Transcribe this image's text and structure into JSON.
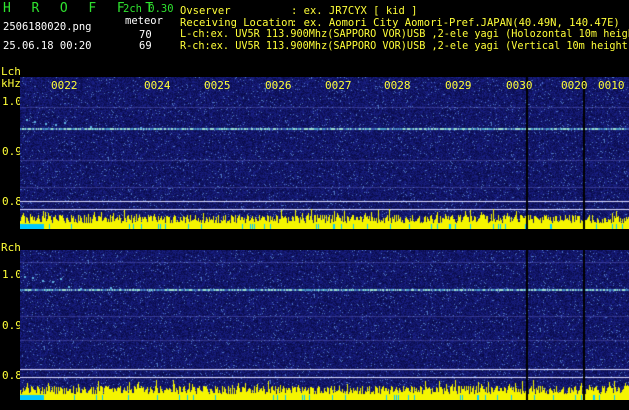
{
  "header": {
    "app_title": "H R O F F T",
    "mode": "2ch 0.30",
    "category": "meteor",
    "filename": "2506180020.png",
    "datetime": "25.06.18 00:20",
    "lch_count": "70",
    "rch_count": "69",
    "observer_label": "Ovserver",
    "observer_value": ": ex. JR7CYX [ kid ]",
    "location_label": "Receiving Location",
    "location_value": ": ex. Aomori City Aomori-Pref.JAPAN(40.49N, 140.47E)",
    "lch_info": "L-ch:ex. UV5R 113.900Mhz(SAPPORO VOR)USB ,2-ele yagi (Holozontal 10m height)",
    "rch_info": "R-ch:ex. UV5R 113.900Mhz(SAPPORO VOR)USB ,2-ele yagi (Vertical 10m height)"
  },
  "lch": {
    "label": "Lch",
    "unit": "kHz",
    "time_ticks": [
      "0022",
      "0024",
      "0025",
      "0026",
      "0027",
      "0028",
      "0029",
      "0030",
      "0020",
      "0010"
    ],
    "freq_ticks": [
      "1.0",
      "0.9",
      "0.8"
    ]
  },
  "rch": {
    "label": "Rch",
    "freq_ticks": [
      "1.0",
      "0.9",
      "0.8"
    ]
  },
  "colors": {
    "text_yellow": "#ffff38",
    "text_green": "#2fe32f",
    "text_white": "#ffffff",
    "background": "#000000",
    "spectrogram_bg": "#0c1070",
    "level_bar": "#f5f500",
    "level_bar_low": "#00c8ff"
  }
}
